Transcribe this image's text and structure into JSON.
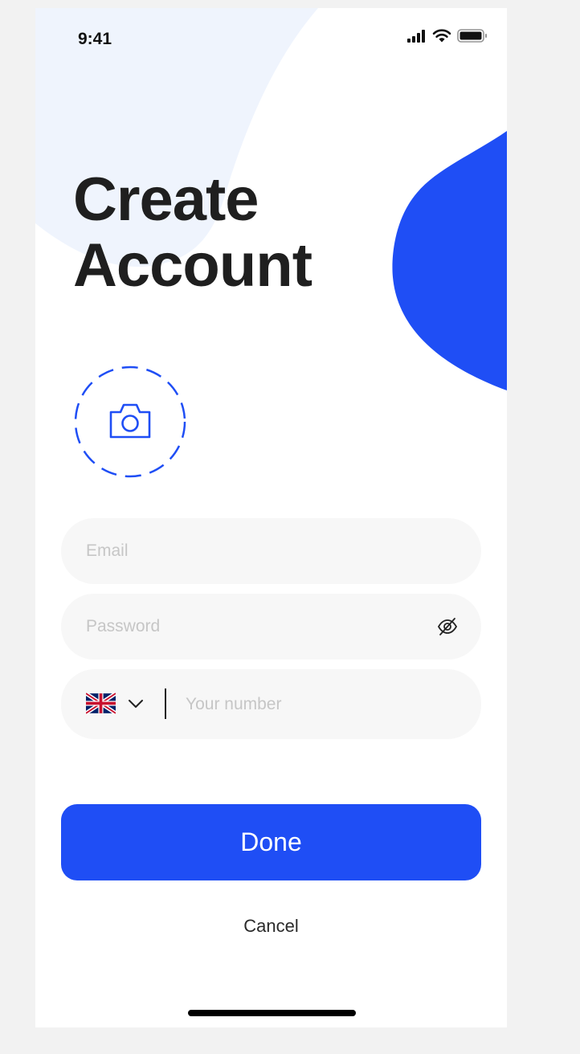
{
  "status_bar": {
    "time": "9:41",
    "icons": [
      "cellular-signal-icon",
      "wifi-icon",
      "battery-icon"
    ]
  },
  "header": {
    "title_line1": "Create",
    "title_line2": "Account"
  },
  "avatar": {
    "icon": "camera-icon"
  },
  "form": {
    "email_placeholder": "Email",
    "email_value": "",
    "password_placeholder": "Password",
    "password_value": "",
    "password_toggle_icon": "eye-off-icon",
    "country_flag_icon": "uk-flag-icon",
    "country_dropdown_icon": "chevron-down-icon",
    "phone_placeholder": "Your number",
    "phone_value": ""
  },
  "actions": {
    "done_label": "Done",
    "cancel_label": "Cancel"
  },
  "colors": {
    "accent": "#1F4EF5",
    "bg_blob": "#EFF4FD",
    "field_bg": "#F7F7F7",
    "title_text": "#1F1F1F",
    "placeholder": "#C6C6C6"
  }
}
